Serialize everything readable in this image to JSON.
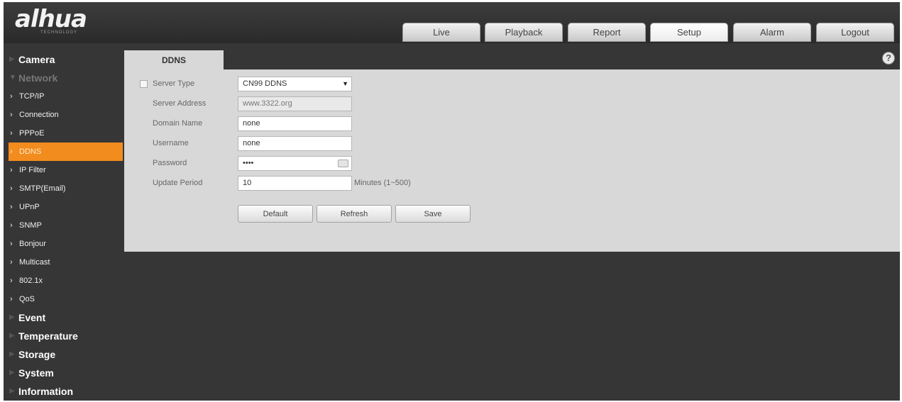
{
  "logo": {
    "brand": "alhua",
    "tagline": "TECHNOLOGY"
  },
  "nav_tabs": [
    {
      "label": "Live"
    },
    {
      "label": "Playback"
    },
    {
      "label": "Report"
    },
    {
      "label": "Setup",
      "active": true
    },
    {
      "label": "Alarm"
    },
    {
      "label": "Logout"
    }
  ],
  "sidebar": {
    "camera": "Camera",
    "network": "Network",
    "network_items": [
      "TCP/IP",
      "Connection",
      "PPPoE",
      "DDNS",
      "IP Filter",
      "SMTP(Email)",
      "UPnP",
      "SNMP",
      "Bonjour",
      "Multicast",
      "802.1x",
      "QoS"
    ],
    "active_item": "DDNS",
    "event": "Event",
    "temperature": "Temperature",
    "storage": "Storage",
    "system": "System",
    "information": "Information"
  },
  "content": {
    "tab_label": "DDNS",
    "help_glyph": "?",
    "form": {
      "server_type_label": "Server Type",
      "server_type_enabled": false,
      "server_type_value": "CN99 DDNS",
      "server_address_label": "Server Address",
      "server_address_value": "www.3322.org",
      "domain_name_label": "Domain Name",
      "domain_name_value": "none",
      "username_label": "Username",
      "username_value": "none",
      "password_label": "Password",
      "password_value": "••••",
      "update_period_label": "Update Period",
      "update_period_value": "10",
      "update_period_unit": "Minutes (1~500)"
    },
    "buttons": {
      "default": "Default",
      "refresh": "Refresh",
      "save": "Save"
    }
  },
  "icons": {
    "help": "help-circle-icon",
    "dropdown": "chevron-down-icon",
    "keyboard": "keyboard-icon",
    "menu_expand": "triangle-right-icon",
    "menu_item": "chevron-right-icon"
  },
  "colors": {
    "accent": "#f28c1e",
    "background": "#363636",
    "panel": "#d8d8d8"
  }
}
